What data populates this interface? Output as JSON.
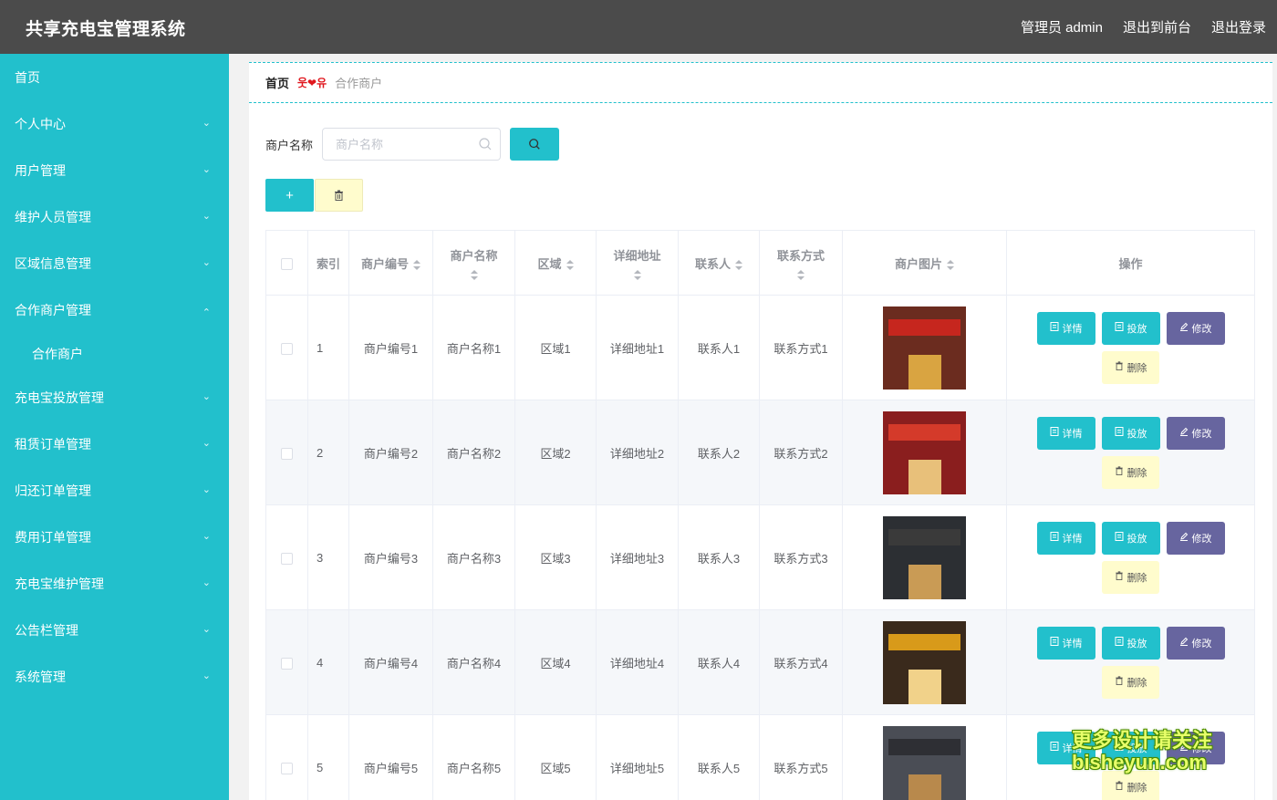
{
  "app": {
    "title": "共享充电宝管理系统",
    "admin_label": "管理员 admin",
    "goto_front": "退出到前台",
    "logout": "退出登录"
  },
  "sidebar": {
    "items": [
      {
        "label": "首页",
        "expandable": false
      },
      {
        "label": "个人中心",
        "expandable": true
      },
      {
        "label": "用户管理",
        "expandable": true
      },
      {
        "label": "维护人员管理",
        "expandable": true
      },
      {
        "label": "区域信息管理",
        "expandable": true
      },
      {
        "label": "合作商户管理",
        "expandable": true,
        "expanded": true
      },
      {
        "label": "充电宝投放管理",
        "expandable": true
      },
      {
        "label": "租赁订单管理",
        "expandable": true
      },
      {
        "label": "归还订单管理",
        "expandable": true
      },
      {
        "label": "费用订单管理",
        "expandable": true
      },
      {
        "label": "充电宝维护管理",
        "expandable": true
      },
      {
        "label": "公告栏管理",
        "expandable": true
      },
      {
        "label": "系统管理",
        "expandable": true
      }
    ],
    "sub_item": "合作商户"
  },
  "breadcrumb": {
    "home": "首页",
    "separator": "웃❤유",
    "current": "合作商户"
  },
  "search": {
    "label": "商户名称",
    "placeholder": "商户名称",
    "value": ""
  },
  "toolbar": {
    "add_icon": "plus-icon",
    "delete_icon": "trash-icon"
  },
  "table": {
    "headers": {
      "index": "索引",
      "code": "商户编号",
      "name": "商户名称",
      "area": "区域",
      "address": "详细地址",
      "contact": "联系人",
      "phone": "联系方式",
      "image": "商户图片",
      "ops": "操作"
    },
    "rows": [
      {
        "index": "1",
        "code": "商户编号1",
        "name": "商户名称1",
        "area": "区域1",
        "address": "详细地址1",
        "contact": "联系人1",
        "phone": "联系方式1"
      },
      {
        "index": "2",
        "code": "商户编号2",
        "name": "商户名称2",
        "area": "区域2",
        "address": "详细地址2",
        "contact": "联系人2",
        "phone": "联系方式2"
      },
      {
        "index": "3",
        "code": "商户编号3",
        "name": "商户名称3",
        "area": "区域3",
        "address": "详细地址3",
        "contact": "联系人3",
        "phone": "联系方式3"
      },
      {
        "index": "4",
        "code": "商户编号4",
        "name": "商户名称4",
        "area": "区域4",
        "address": "详细地址4",
        "contact": "联系人4",
        "phone": "联系方式4"
      },
      {
        "index": "5",
        "code": "商户编号5",
        "name": "商户名称5",
        "area": "区域5",
        "address": "详细地址5",
        "contact": "联系人5",
        "phone": "联系方式5"
      }
    ],
    "row_actions": {
      "view": "详情",
      "deploy": "投放",
      "edit": "修改",
      "delete": "删除"
    }
  },
  "watermark": {
    "line1": "更多设计请关注",
    "line2": "bisheyun.com"
  },
  "colors": {
    "accent": "#22c0cc",
    "topbar": "#4b4b4b",
    "edit_button": "#67659f",
    "delete_button": "#fffccd"
  }
}
